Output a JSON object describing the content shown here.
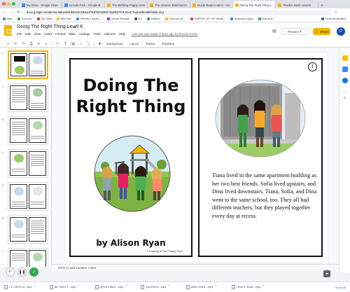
{
  "browser": {
    "tabs": [
      {
        "label": "My Drive - Google Drive",
        "color": "#4285f4"
      },
      {
        "label": "Lincoln Park - Google D",
        "color": "#4285f4"
      },
      {
        "label": "The Birthday Puppy Leve",
        "color": "#f4b400"
      },
      {
        "label": "The Amazon Rainforest L",
        "color": "#f4b400"
      },
      {
        "label": "Guide Bugs Level H - Go",
        "color": "#f4b400"
      },
      {
        "label": "Doing The Right Thing L",
        "color": "#f4b400"
      },
      {
        "label": "Teacher Book Level K",
        "color": "#f4b400"
      }
    ],
    "url": "docs.google.com/presentation/d/1lGKoSVc9SxHPE87BCM9rD7KpRk37FzLXsuC7ogruel9eddit#slide=id.p",
    "bookmarks": [
      "Apps",
      "Gold acc",
      "Top Shop",
      "Mac Mac",
      "Hbtrees / Adult L...",
      "Library Website",
      "OG",
      "Tabfor's",
      "Gold acc kiv...",
      "CARSON UP ! B+ Aleido...",
      "Instruction gaps",
      "Bold Unit",
      "Other Bookmarks"
    ]
  },
  "app": {
    "doc_title": "Doing The Right Thing Level K",
    "menu": [
      "File",
      "Edit",
      "View",
      "Insert",
      "Format",
      "Slide",
      "Arrange",
      "Tools",
      "Add-ons",
      "Help"
    ],
    "last_edit": "Last edit was made 3 days ago by Bonnie Porter",
    "present_label": "Present",
    "share_label": "Share",
    "avatar_letter": "P",
    "brand_color": "#f4b400"
  },
  "toolbar": {
    "background_label": "Background",
    "layout_label": "Layout",
    "theme_label": "Theme",
    "transition_label": "Transition"
  },
  "filmstrip": {
    "numbers": [
      "1",
      "2",
      "3",
      "4",
      "5",
      "6",
      "7",
      "8"
    ]
  },
  "slide": {
    "cover_title_line1": "Doing The",
    "cover_title_line2": "Right Thing",
    "author": "by Alison Ryan",
    "credit": "© Learning At The Primary Pond",
    "page_number": "1",
    "story": "Tiana lived in the same apartment building as her two best friends. Sofia lived upstairs, and Dina lived downstairs. Tiana, Sofia, and Dina went to the same school, too. They all had different teachers, but they played together every day at recess."
  },
  "notes": {
    "placeholder": "Click to add speaker notes"
  },
  "downloads": [
    "I.1T 1ECD.m...mp4",
    "8D 7M9 II.T...mp4",
    "2(1J10L9A9J...mp4",
    "2(1J19C01...mp4",
    "8045 CSID1...mp4",
    "Level K Smde...mp4"
  ],
  "downloads_show_all": "Show all"
}
